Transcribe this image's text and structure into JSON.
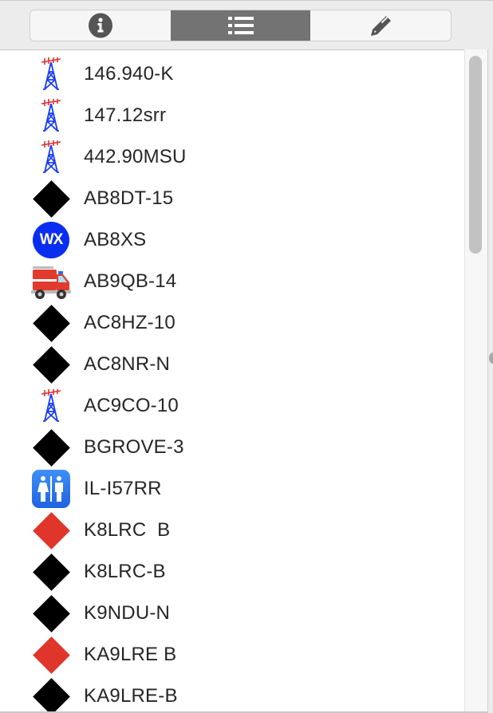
{
  "toolbar": {
    "segments": [
      {
        "name": "info",
        "icon": "info-icon",
        "active": false
      },
      {
        "name": "list",
        "icon": "list-icon",
        "active": true
      },
      {
        "name": "edit",
        "icon": "pencil-icon",
        "active": false
      }
    ]
  },
  "colors": {
    "active_segment": "#737373",
    "diamond_black": "#000000",
    "diamond_red": "#e0352b",
    "wx_blue": "#0a2ef0",
    "tower_blue": "#1a3ef0",
    "tower_red": "#e03030"
  },
  "stations": [
    {
      "label": "146.940-K",
      "icon": "radio-tower-icon"
    },
    {
      "label": "147.12srr",
      "icon": "radio-tower-icon"
    },
    {
      "label": "442.90MSU",
      "icon": "radio-tower-icon"
    },
    {
      "label": "AB8DT-15",
      "icon": "black-diamond-icon"
    },
    {
      "label": "AB8XS",
      "icon": "wx-weather-icon",
      "icon_text": "WX"
    },
    {
      "label": "AB9QB-14",
      "icon": "fire-truck-icon"
    },
    {
      "label": "AC8HZ-10",
      "icon": "black-diamond-icon"
    },
    {
      "label": "AC8NR-N",
      "icon": "black-diamond-icon"
    },
    {
      "label": "AC9CO-10",
      "icon": "radio-tower-icon"
    },
    {
      "label": "BGROVE-3",
      "icon": "black-diamond-icon"
    },
    {
      "label": "IL-I57RR",
      "icon": "restroom-icon"
    },
    {
      "label": "K8LRC  B",
      "icon": "red-diamond-icon"
    },
    {
      "label": "K8LRC-B",
      "icon": "black-diamond-icon"
    },
    {
      "label": "K9NDU-N",
      "icon": "black-diamond-icon"
    },
    {
      "label": "KA9LRE B",
      "icon": "red-diamond-icon"
    },
    {
      "label": "KA9LRE-B",
      "icon": "black-diamond-icon"
    }
  ]
}
